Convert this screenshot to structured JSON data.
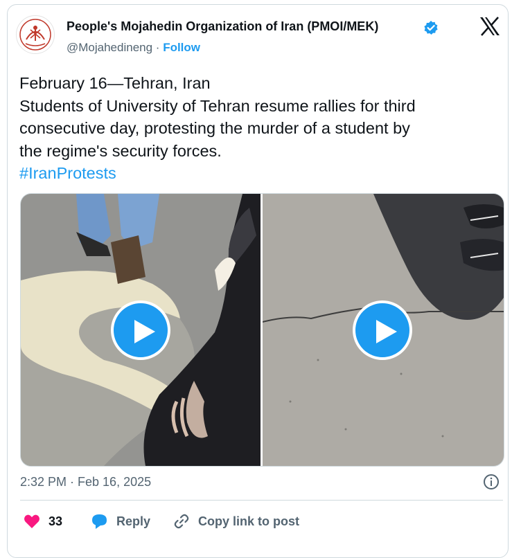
{
  "author": {
    "name": "People's Mojahedin Organization of Iran (PMOI/MEK)",
    "handle": "@Mojahedineng",
    "separator": " · ",
    "follow_label": "Follow",
    "verified": true,
    "avatar_icon": "pmoi-emblem-icon"
  },
  "platform_icon": "x-logo-icon",
  "tweet": {
    "lines": [
      "February 16—Tehran, Iran",
      "Students of University of Tehran resume rallies for third",
      "consecutive day, protesting the murder of a student by",
      "the regime's security forces."
    ],
    "hashtag": "#IranProtests"
  },
  "media": {
    "items": [
      {
        "type": "video",
        "icon": "play-icon"
      },
      {
        "type": "video",
        "icon": "play-icon"
      }
    ]
  },
  "meta": {
    "timestamp": "2:32 PM · Feb 16, 2025",
    "info_icon": "info-icon"
  },
  "actions": {
    "like_count": "33",
    "reply_label": "Reply",
    "copy_link_label": "Copy link to post"
  },
  "colors": {
    "accent": "#1d9bf0",
    "like": "#f91880",
    "text": "#0f1419",
    "muted": "#536471",
    "border": "#cfd9de"
  }
}
